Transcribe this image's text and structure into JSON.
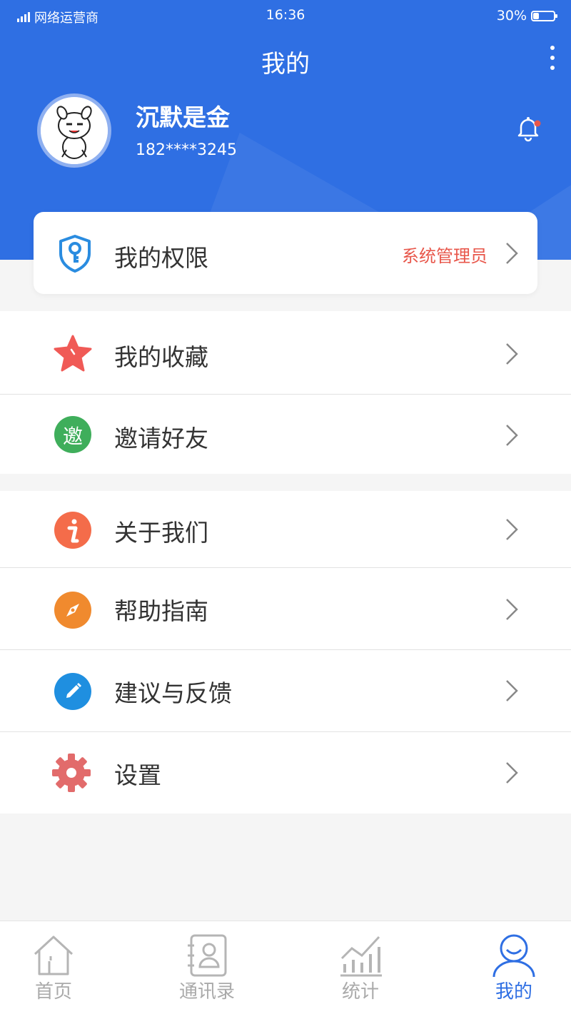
{
  "status_bar": {
    "carrier": "网络运营商",
    "time": "16:36",
    "battery": "30%",
    "battery_level": 0.3
  },
  "header": {
    "title": "我的"
  },
  "profile": {
    "name": "沉默是金",
    "phone": "182****3245"
  },
  "permission": {
    "label": "我的权限",
    "value": "系统管理员"
  },
  "menu_group1": [
    {
      "label": "我的收藏",
      "icon": "star-icon",
      "color": "#f05a56"
    },
    {
      "label": "邀请好友",
      "icon": "invite-icon",
      "icon_text": "邀",
      "color": "#3fae5b"
    }
  ],
  "menu_group2": [
    {
      "label": "关于我们",
      "icon": "info-icon",
      "color": "#f46c4a"
    },
    {
      "label": "帮助指南",
      "icon": "compass-icon",
      "color": "#f08a2e"
    },
    {
      "label": "建议与反馈",
      "icon": "pencil-icon",
      "color": "#1f8fe0"
    },
    {
      "label": "设置",
      "icon": "gear-icon",
      "color": "#e26b6b"
    }
  ],
  "tabbar": [
    {
      "label": "首页",
      "icon": "home-icon",
      "active": false
    },
    {
      "label": "通讯录",
      "icon": "contacts-icon",
      "active": false
    },
    {
      "label": "统计",
      "icon": "chart-icon",
      "active": false
    },
    {
      "label": "我的",
      "icon": "profile-icon",
      "active": true
    }
  ],
  "colors": {
    "primary": "#2f6fe3",
    "alert": "#e8574b",
    "background": "#f5f5f5"
  }
}
